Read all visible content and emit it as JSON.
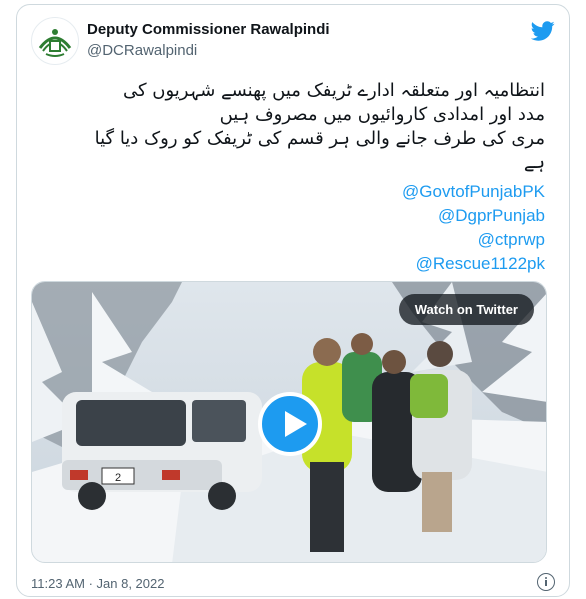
{
  "tweet": {
    "author_name": "Deputy Commissioner Rawalpindi",
    "author_handle": "@DCRawalpindi",
    "text_lines": [
      "انتظامیہ اور متعلقہ ادارے ٹریفک میں پھنسے شہریوں کی",
      "مدد اور امدادی کاروائیوں میں مصروف ہیں",
      "مری کی طرف جانے والی ہر قسم کی ٹریفک کو روک دیا گیا",
      "ہے"
    ],
    "mentions": [
      "@GovtofPunjabPK",
      "@DgprPunjab",
      "@ctprwp",
      "@Rescue1122pk"
    ],
    "media": {
      "watch_label": "Watch on Twitter",
      "license_plate": "2"
    },
    "timestamp": "11:23 AM · Jan 8, 2022"
  },
  "colors": {
    "link": "#1d9bf0",
    "text": "#0f1419",
    "secondary": "#536471",
    "border": "#cfd9de"
  },
  "icons": [
    "twitter-bird-icon",
    "play-icon",
    "info-icon",
    "punjab-logo-avatar"
  ]
}
